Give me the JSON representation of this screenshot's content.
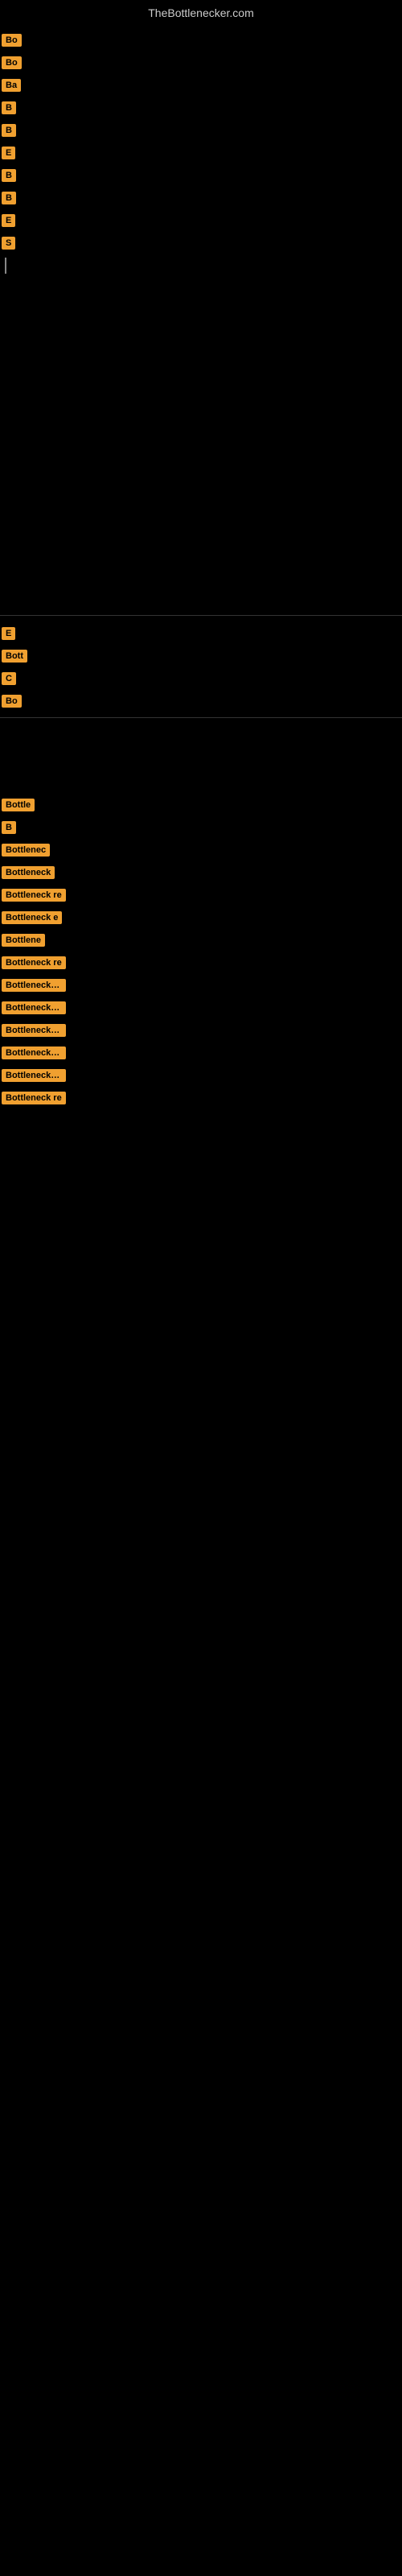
{
  "site": {
    "title": "TheBottlenecker.com"
  },
  "rows": [
    {
      "badge": "Bo",
      "label": ""
    },
    {
      "badge": "Bo",
      "label": ""
    },
    {
      "badge": "Ba",
      "label": ""
    },
    {
      "badge": "B",
      "label": ""
    },
    {
      "badge": "B",
      "label": ""
    },
    {
      "badge": "E",
      "label": ""
    },
    {
      "badge": "B",
      "label": ""
    },
    {
      "badge": "B",
      "label": ""
    },
    {
      "badge": "E",
      "label": ""
    },
    {
      "badge": "S",
      "label": ""
    },
    {
      "badge": null,
      "label": "",
      "line": true
    }
  ],
  "section2": [
    {
      "badge": "E",
      "label": ""
    },
    {
      "badge": "Bott",
      "label": ""
    },
    {
      "badge": "C",
      "label": ""
    },
    {
      "badge": "Bo",
      "label": ""
    }
  ],
  "section3": [
    {
      "badge": "Bottle",
      "label": ""
    },
    {
      "badge": "B",
      "label": ""
    },
    {
      "badge": "Bottlenec",
      "label": ""
    },
    {
      "badge": "Bottleneck",
      "label": ""
    },
    {
      "badge": "Bottleneck re",
      "label": ""
    },
    {
      "badge": "Bottleneck e",
      "label": ""
    },
    {
      "badge": "Bottlene",
      "label": ""
    },
    {
      "badge": "Bottleneck re",
      "label": ""
    },
    {
      "badge": "Bottleneck resu",
      "label": ""
    },
    {
      "badge": "Bottleneck resu",
      "label": ""
    },
    {
      "badge": "Bottleneck resu",
      "label": ""
    },
    {
      "badge": "Bottleneck resu",
      "label": ""
    },
    {
      "badge": "Bottleneck resu",
      "label": ""
    },
    {
      "badge": "Bottleneck re",
      "label": ""
    }
  ]
}
